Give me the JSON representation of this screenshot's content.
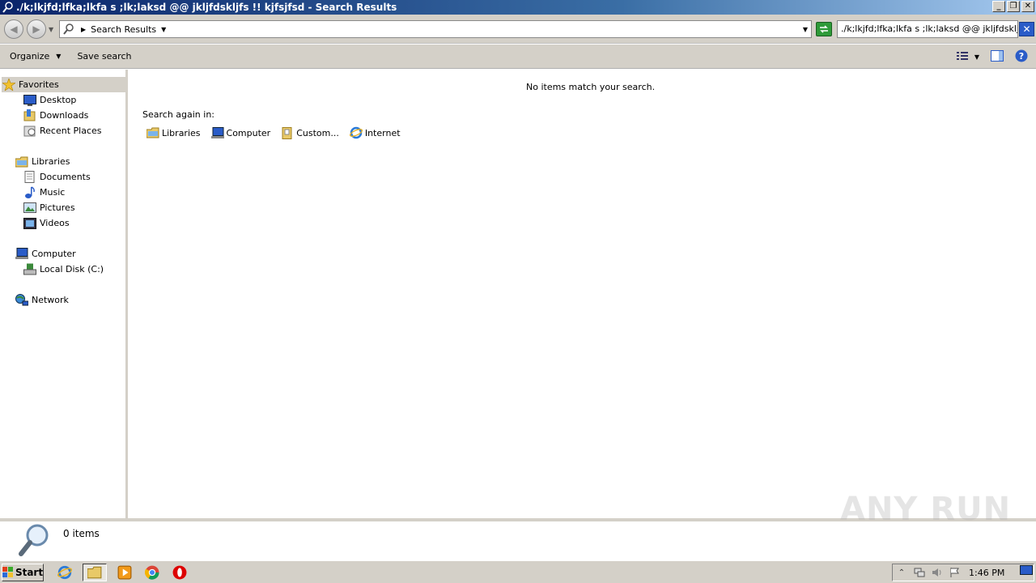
{
  "window": {
    "title": "./k;lkjfd;lfka;lkfa s ;lk;laksd @@ jkljfdskljfs !! kjfsjfsd - Search Results",
    "controls": {
      "minimize": "_",
      "restore": "❐",
      "close": "✕"
    }
  },
  "address": {
    "crumb": "Search Results",
    "search_value": "./k;lkjfd;lfka;lkfa s ;lk;laksd @@ jkljfdskljfs"
  },
  "toolbar": {
    "organize_label": "Organize",
    "save_search_label": "Save search"
  },
  "navigation": {
    "favorites": {
      "label": "Favorites",
      "items": [
        "Desktop",
        "Downloads",
        "Recent Places"
      ]
    },
    "libraries": {
      "label": "Libraries",
      "items": [
        "Documents",
        "Music",
        "Pictures",
        "Videos"
      ]
    },
    "computer": {
      "label": "Computer",
      "items": [
        "Local Disk (C:)"
      ]
    },
    "network": {
      "label": "Network"
    }
  },
  "content": {
    "empty_message": "No items match your search.",
    "search_again_label": "Search again in:",
    "search_again_items": [
      "Libraries",
      "Computer",
      "Custom...",
      "Internet"
    ]
  },
  "details": {
    "item_count": "0 items"
  },
  "watermark": "ANY RUN",
  "taskbar": {
    "start_label": "Start",
    "clock": "1:46 PM"
  },
  "colors": {
    "titlebar_start": "#0a246a",
    "titlebar_end": "#a6caf0",
    "chrome": "#d4d0c8"
  }
}
